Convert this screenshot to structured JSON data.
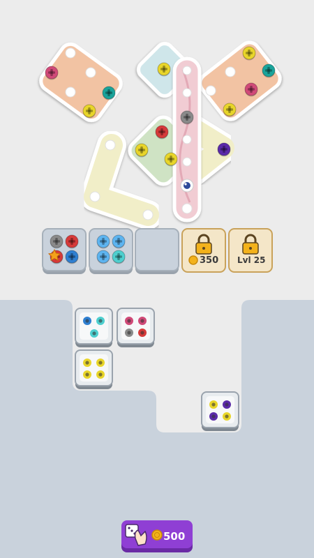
{
  "colors": {
    "background": "#ececec",
    "tray_area": "#c9d2dc",
    "plate_orange": "#f2c3a3",
    "plate_blue": "#cfe6ea",
    "plate_pink": "#f1ccd3",
    "plate_green": "#cfe3c4",
    "plate_yellow": "#f1eec8",
    "screw_pink": "#d04a78",
    "screw_teal": "#1aa39a",
    "screw_yellow": "#e8d52a",
    "screw_red": "#d63a3a",
    "screw_gray": "#8a8a8a",
    "screw_purple": "#5a2aa8",
    "screw_blue": "#2e7fd1",
    "screw_light_blue": "#5db4f0",
    "screw_cyan": "#4ecfcf",
    "button_purple": "#8f3fd4",
    "coin": "#f3b21b",
    "lock": "#f3b21b"
  },
  "toolbox_slots": [
    {
      "id": "slot-1",
      "state": "filled",
      "screws": [
        "gray",
        "red",
        "red",
        "blue"
      ],
      "star": true
    },
    {
      "id": "slot-2",
      "state": "filled",
      "screws": [
        "light_blue",
        "light_blue",
        "light_blue",
        "cyan"
      ]
    },
    {
      "id": "slot-3",
      "state": "empty"
    },
    {
      "id": "slot-4",
      "state": "locked",
      "price": "350",
      "icon": "coin-icon"
    },
    {
      "id": "slot-5",
      "state": "locked",
      "label": "Lvl 25"
    }
  ],
  "boxes": [
    {
      "id": "box-cyan-blue",
      "holes": [
        "blue",
        "cyan",
        "cyan"
      ]
    },
    {
      "id": "box-pink-gray",
      "holes": [
        "pink",
        "pink",
        "gray",
        "red"
      ]
    },
    {
      "id": "box-yellow",
      "holes": [
        "yellow",
        "yellow",
        "yellow",
        "yellow"
      ]
    },
    {
      "id": "box-purple-yellow",
      "holes": [
        "yellow",
        "purple",
        "purple",
        "yellow"
      ]
    }
  ],
  "shuffle_button": {
    "price": "500",
    "icon": "hand-dice-icon",
    "coin_icon": "coin-icon"
  }
}
